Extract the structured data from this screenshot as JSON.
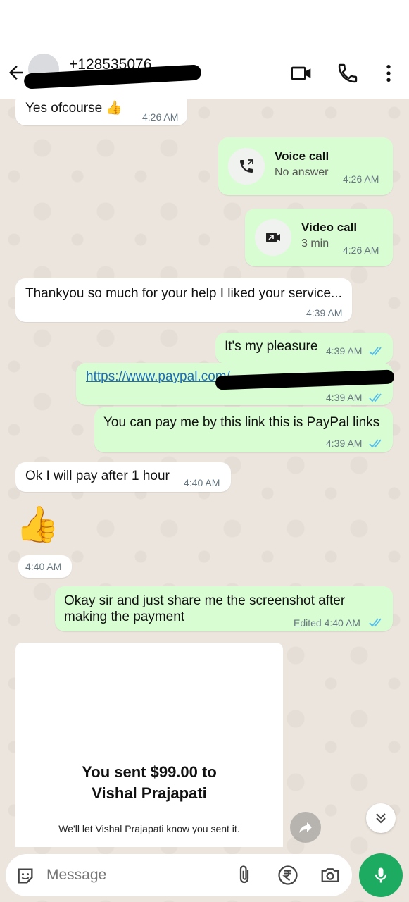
{
  "header": {
    "contact": "+128535076",
    "icons": [
      "back-arrow-icon",
      "video-call-icon",
      "phone-icon",
      "more-vert-icon"
    ]
  },
  "messages": {
    "m1": {
      "text": "Yes ofcourse 👍",
      "time": "4:26 AM"
    },
    "voice": {
      "title": "Voice call",
      "sub": "No answer",
      "time": "4:26 AM"
    },
    "video": {
      "title": "Video call",
      "sub": "3 min",
      "time": "4:26 AM"
    },
    "m2": {
      "text": "Thankyou so much for your help I liked your service...",
      "time": "4:39 AM"
    },
    "m3": {
      "text": "It's my pleasure",
      "time": "4:39 AM"
    },
    "m4": {
      "text": "https://www.paypal.com/",
      "time": "4:39 AM"
    },
    "m5": {
      "text": "You can pay me by this link this is PayPal links",
      "time": "4:39 AM"
    },
    "m6": {
      "text": "Ok I will pay after 1 hour",
      "time": "4:40 AM"
    },
    "m7": {
      "text": "👍",
      "time": "4:40 AM"
    },
    "m8": {
      "line1": "Okay sir and just share me the screenshot after",
      "line2": "making the payment",
      "time": "Edited 4:40 AM"
    }
  },
  "receipt": {
    "title_line1": "You sent $99.00 to",
    "title_line2": "Vishal Prajapati",
    "subtitle": "We'll let Vishal Prajapati know you sent it."
  },
  "composer": {
    "placeholder": "Message"
  },
  "colors": {
    "outgoing": "#d9fdd3",
    "incoming": "#ffffff",
    "mic": "#1dab61",
    "ticks": "#53bdeb"
  }
}
